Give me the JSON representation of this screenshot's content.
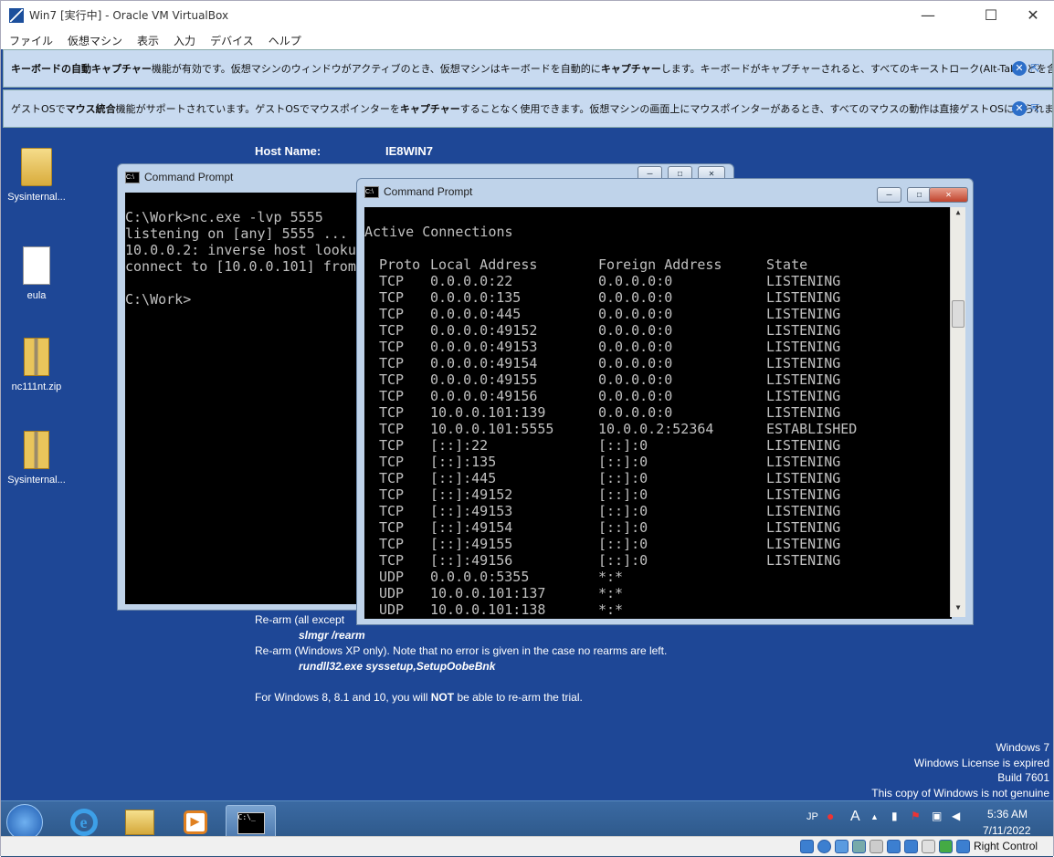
{
  "window": {
    "title": "Win7 [実行中] - Oracle VM VirtualBox",
    "minimize": "—",
    "maximize": "☐",
    "close": "✕"
  },
  "menu": [
    "ファイル",
    "仮想マシン",
    "表示",
    "入力",
    "デバイス",
    "ヘルプ"
  ],
  "notices": [
    {
      "pre": "",
      "bold1": "キーボードの自動キャプチャー",
      "mid": "機能が有効です。仮想マシンのウィンドウがアクティブのとき、仮想マシンはキーボードを自動的に",
      "bold2": "キャプチャー",
      "post": "します。キーボードがキャプチャーされると、すべてのキーストローク(Alt-Tabなどを含む)が仮想"
    },
    {
      "pre": "ゲストOSで",
      "bold1": "マウス統合",
      "mid": "機能がサポートされています。ゲストOSでマウスポインターを",
      "bold2": "キャプチャー",
      "post": "することなく使用できます。仮想マシンの画面上にマウスポインターがあるとき、すべてのマウスの動作は直接ゲストOSに送られます。現在マウス"
    }
  ],
  "desktop_icons": [
    "Sysinternal...",
    "eula",
    "nc111nt.zip",
    "Sysinternal..."
  ],
  "bginfo": {
    "host_label": "Host Name:",
    "host_value": "IE8WIN7",
    "rearm1": "Re-arm (all except",
    "cmd1": "slmgr /rearm",
    "rearm2": "Re-arm (Windows XP only). Note that no error is given in the case no rearms are left.",
    "cmd2": "rundll32.exe syssetup,SetupOobeBnk",
    "w8_pre": "For Windows 8, 8.1 and 10, you will ",
    "w8_bold": "NOT",
    "w8_post": " be able to re-arm the trial."
  },
  "cmd_back": {
    "title": "Command Prompt",
    "lines": [
      "",
      "C:\\Work>nc.exe -lvp 5555",
      "listening on [any] 5555 ...",
      "10.0.0.2: inverse host lookup fa",
      "connect to [10.0.0.101] from (UN",
      "",
      "C:\\Work>"
    ]
  },
  "cmd_front": {
    "title": "Command Prompt",
    "heading": "Active Connections",
    "columns": [
      "Proto",
      "Local Address",
      "Foreign Address",
      "State"
    ],
    "rows": [
      [
        "TCP",
        "0.0.0.0:22",
        "0.0.0.0:0",
        "LISTENING"
      ],
      [
        "TCP",
        "0.0.0.0:135",
        "0.0.0.0:0",
        "LISTENING"
      ],
      [
        "TCP",
        "0.0.0.0:445",
        "0.0.0.0:0",
        "LISTENING"
      ],
      [
        "TCP",
        "0.0.0.0:49152",
        "0.0.0.0:0",
        "LISTENING"
      ],
      [
        "TCP",
        "0.0.0.0:49153",
        "0.0.0.0:0",
        "LISTENING"
      ],
      [
        "TCP",
        "0.0.0.0:49154",
        "0.0.0.0:0",
        "LISTENING"
      ],
      [
        "TCP",
        "0.0.0.0:49155",
        "0.0.0.0:0",
        "LISTENING"
      ],
      [
        "TCP",
        "0.0.0.0:49156",
        "0.0.0.0:0",
        "LISTENING"
      ],
      [
        "TCP",
        "10.0.0.101:139",
        "0.0.0.0:0",
        "LISTENING"
      ],
      [
        "TCP",
        "10.0.0.101:5555",
        "10.0.0.2:52364",
        "ESTABLISHED"
      ],
      [
        "TCP",
        "[::]:22",
        "[::]:0",
        "LISTENING"
      ],
      [
        "TCP",
        "[::]:135",
        "[::]:0",
        "LISTENING"
      ],
      [
        "TCP",
        "[::]:445",
        "[::]:0",
        "LISTENING"
      ],
      [
        "TCP",
        "[::]:49152",
        "[::]:0",
        "LISTENING"
      ],
      [
        "TCP",
        "[::]:49153",
        "[::]:0",
        "LISTENING"
      ],
      [
        "TCP",
        "[::]:49154",
        "[::]:0",
        "LISTENING"
      ],
      [
        "TCP",
        "[::]:49155",
        "[::]:0",
        "LISTENING"
      ],
      [
        "TCP",
        "[::]:49156",
        "[::]:0",
        "LISTENING"
      ],
      [
        "UDP",
        "0.0.0.0:5355",
        "*:*",
        ""
      ],
      [
        "UDP",
        "10.0.0.101:137",
        "*:*",
        ""
      ],
      [
        "UDP",
        "10.0.0.101:138",
        "*:*",
        ""
      ]
    ]
  },
  "watermark": [
    "Windows 7",
    "Windows License is expired",
    "Build 7601",
    "This copy of Windows is not genuine"
  ],
  "tray": {
    "lang": "JP",
    "ime": "A",
    "time": "5:36 AM",
    "date": "7/11/2022"
  },
  "status": {
    "host_key": "Right Control"
  }
}
